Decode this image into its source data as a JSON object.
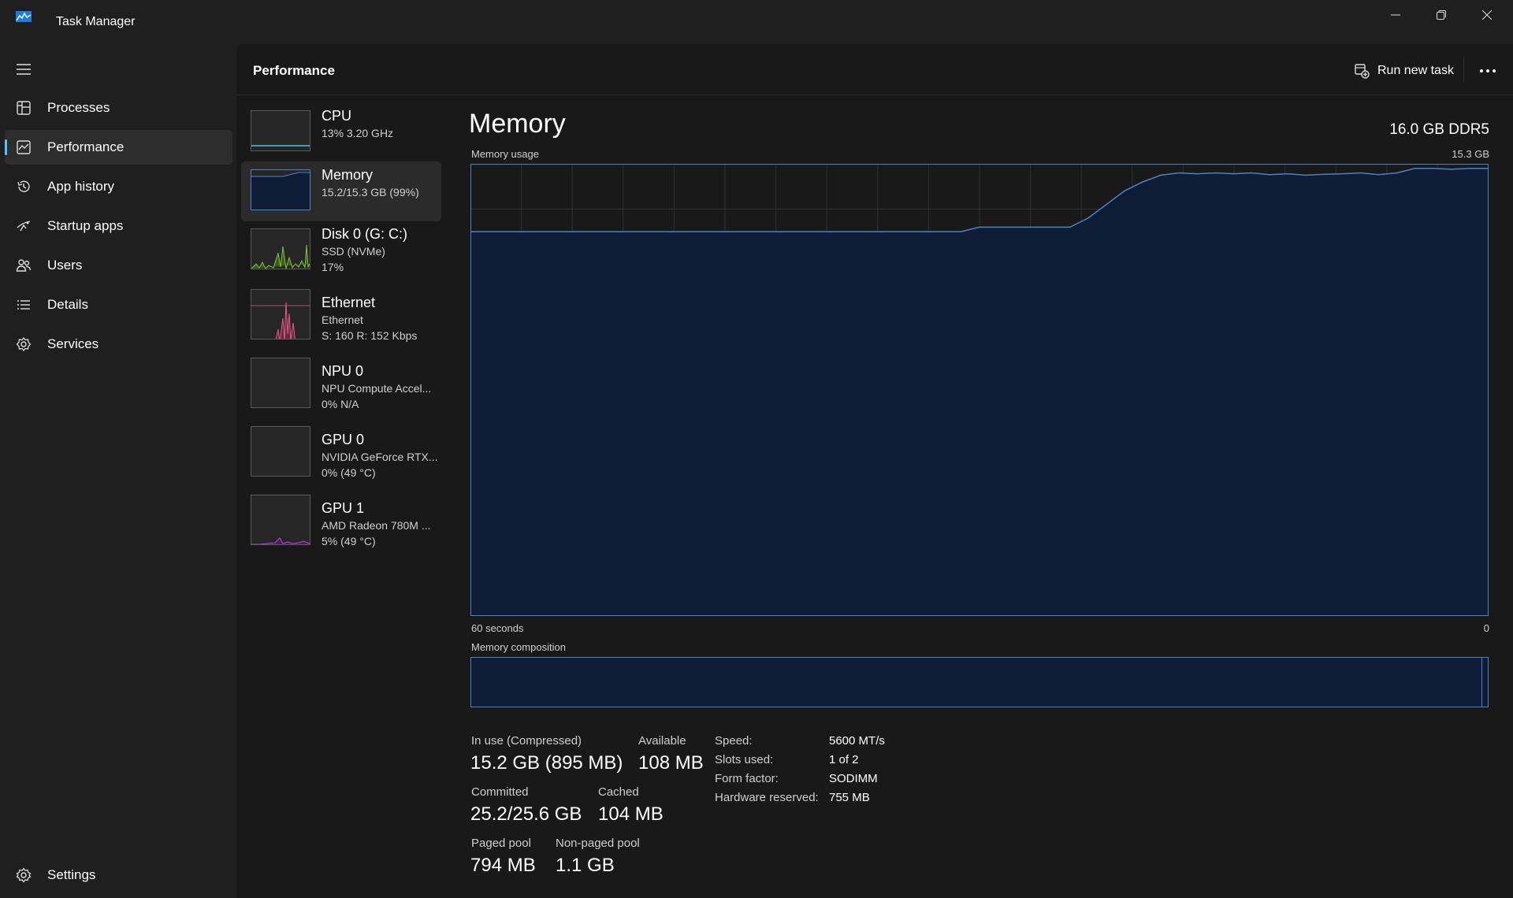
{
  "app": {
    "title": "Task Manager"
  },
  "window_controls": [
    "minimize-icon",
    "restore-icon",
    "close-icon"
  ],
  "sidebar": {
    "items": [
      {
        "label": "Processes",
        "icon": "processes-icon",
        "active": false
      },
      {
        "label": "Performance",
        "icon": "performance-icon",
        "active": true
      },
      {
        "label": "App history",
        "icon": "app-history-icon",
        "active": false
      },
      {
        "label": "Startup apps",
        "icon": "startup-apps-icon",
        "active": false
      },
      {
        "label": "Users",
        "icon": "users-icon",
        "active": false
      },
      {
        "label": "Details",
        "icon": "details-icon",
        "active": false
      },
      {
        "label": "Services",
        "icon": "services-icon",
        "active": false
      }
    ],
    "settings_label": "Settings"
  },
  "header": {
    "title": "Performance",
    "run_new_task": "Run new task"
  },
  "devices": [
    {
      "name": "CPU",
      "sub": "13%  3.20 GHz",
      "sub2": "",
      "color": "#4cc2ff"
    },
    {
      "name": "Memory",
      "sub": "15.2/15.3 GB (99%)",
      "sub2": "",
      "color": "#4a82c8"
    },
    {
      "name": "Disk 0 (G: C:)",
      "sub": "SSD (NVMe)",
      "sub2": "17%",
      "color": "#7ec13a"
    },
    {
      "name": "Ethernet",
      "sub": "Ethernet",
      "sub2": "S: 160  R: 152 Kbps",
      "color": "#e05c8a"
    },
    {
      "name": "NPU 0",
      "sub": "NPU Compute Accel...",
      "sub2": "0%  N/A",
      "color": "#8a8a8a"
    },
    {
      "name": "GPU 0",
      "sub": "NVIDIA GeForce RTX...",
      "sub2": "0% (49 °C)",
      "color": "#8a8a8a"
    },
    {
      "name": "GPU 1",
      "sub": "AMD Radeon 780M ...",
      "sub2": "5% (49 °C)",
      "color": "#b44bd6"
    }
  ],
  "memory": {
    "title": "Memory",
    "capacity": "16.0 GB DDR5",
    "usage_label": "Memory usage",
    "usage_max": "15.3 GB",
    "time_left": "60 seconds",
    "time_right": "0",
    "composition_label": "Memory composition",
    "usage_series_fraction": [
      0.85,
      0.85,
      0.85,
      0.85,
      0.85,
      0.85,
      0.85,
      0.85,
      0.85,
      0.85,
      0.85,
      0.85,
      0.85,
      0.85,
      0.85,
      0.85,
      0.85,
      0.85,
      0.85,
      0.85,
      0.85,
      0.85,
      0.85,
      0.85,
      0.85,
      0.85,
      0.85,
      0.85,
      0.86,
      0.86,
      0.86,
      0.86,
      0.86,
      0.86,
      0.88,
      0.91,
      0.94,
      0.96,
      0.975,
      0.98,
      0.978,
      0.98,
      0.978,
      0.98,
      0.976,
      0.978,
      0.975,
      0.977,
      0.978,
      0.98,
      0.976,
      0.98,
      0.99,
      0.99,
      0.988,
      0.99,
      0.99
    ],
    "stats": {
      "in_use_label": "In use (Compressed)",
      "in_use": "15.2 GB (895 MB)",
      "available_label": "Available",
      "available": "108 MB",
      "committed_label": "Committed",
      "committed": "25.2/25.6 GB",
      "cached_label": "Cached",
      "cached": "104 MB",
      "paged_label": "Paged pool",
      "paged": "794 MB",
      "nonpaged_label": "Non-paged pool",
      "nonpaged": "1.1 GB"
    },
    "details": [
      {
        "key": "Speed:",
        "value": "5600 MT/s"
      },
      {
        "key": "Slots used:",
        "value": "1 of 2"
      },
      {
        "key": "Form factor:",
        "value": "SODIMM"
      },
      {
        "key": "Hardware reserved:",
        "value": "755 MB"
      }
    ]
  }
}
